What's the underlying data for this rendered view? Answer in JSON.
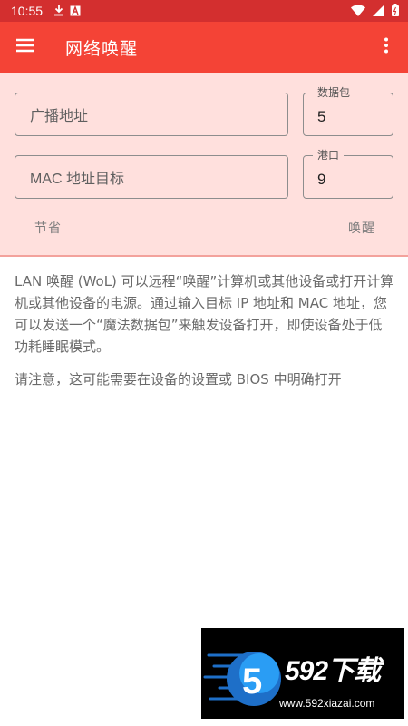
{
  "status_bar": {
    "time": "10:55"
  },
  "app_bar": {
    "title": "网络唤醒"
  },
  "form": {
    "broadcast_placeholder": "广播地址",
    "packets": {
      "label": "数据包",
      "value": "5"
    },
    "mac_placeholder": "MAC 地址目标",
    "port": {
      "label": "港口",
      "value": "9"
    },
    "save_label": "节省",
    "wake_label": "唤醒"
  },
  "content": {
    "paragraph1": "LAN 唤醒 (WoL) 可以远程“唤醒”计算机或其他设备或打开计算机或其他设备的电源。通过输入目标 IP 地址和 MAC 地址，您可以发送一个“魔法数据包”来触发设备打开，即使设备处于低功耗睡眠模式。",
    "paragraph2": "请注意，这可能需要在设备的设置或 BIOS 中明确打开"
  },
  "watermark": {
    "brand": "592下载",
    "url": "www.592xiazai.com"
  },
  "colors": {
    "status_bar": "#d32f2f",
    "app_bar": "#f44336",
    "panel": "#ffe0dd",
    "divider": "#f3a29c"
  },
  "icons": [
    "download-icon",
    "notification-a-icon",
    "wifi-icon",
    "signal-icon",
    "battery-icon",
    "menu-icon",
    "more-vert-icon"
  ]
}
